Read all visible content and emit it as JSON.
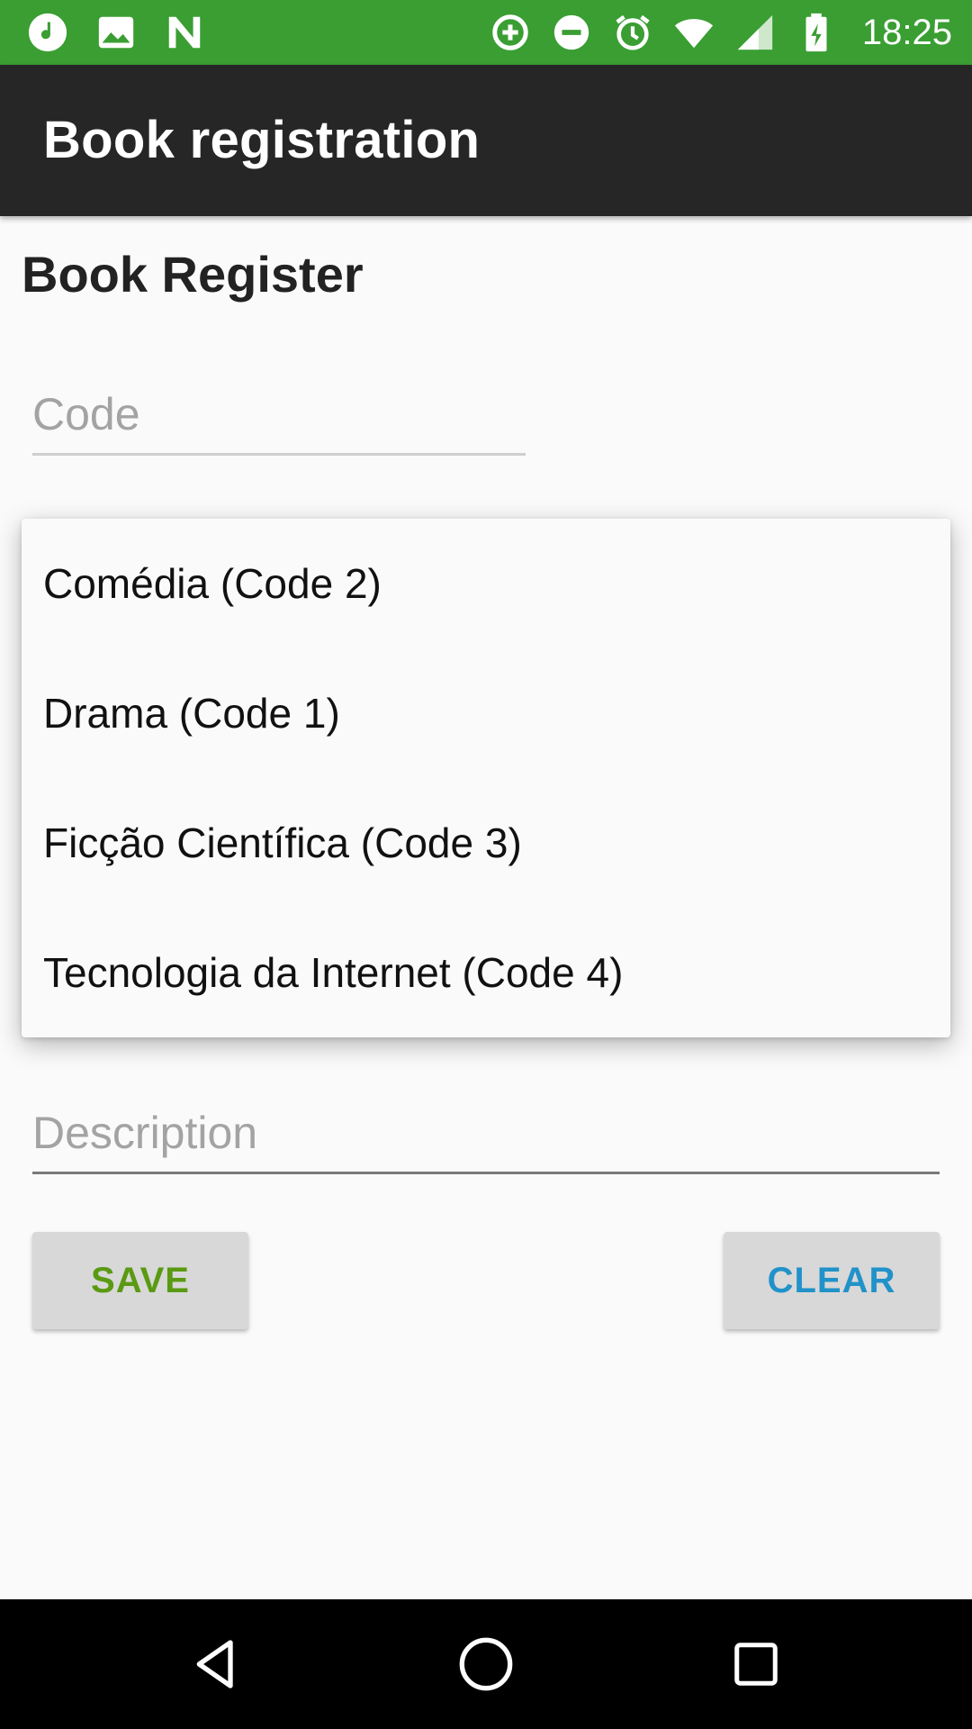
{
  "status_bar": {
    "time": "18:25",
    "background": "#3a9e33",
    "left_icons": [
      "music-note-icon",
      "image-icon",
      "n-logo-icon"
    ],
    "right_icons": [
      "data-saver-icon",
      "do-not-disturb-icon",
      "alarm-icon",
      "wifi-icon",
      "cellular-signal-icon",
      "battery-charging-icon"
    ]
  },
  "app_bar": {
    "title": "Book registration",
    "background": "#262626"
  },
  "form": {
    "heading": "Book Register",
    "code_placeholder": "Code",
    "description_placeholder": "Description",
    "save_label": "SAVE",
    "clear_label": "CLEAR",
    "save_color": "#5a9a12",
    "clear_color": "#2192c9"
  },
  "genre_dropdown": {
    "options": [
      "Comédia (Code 2)",
      "Drama (Code 1)",
      "Ficção Científica (Code 3)",
      "Tecnologia da Internet (Code 4)"
    ]
  },
  "nav_bar": {
    "icons": [
      "back-icon",
      "home-icon",
      "recents-icon"
    ]
  }
}
